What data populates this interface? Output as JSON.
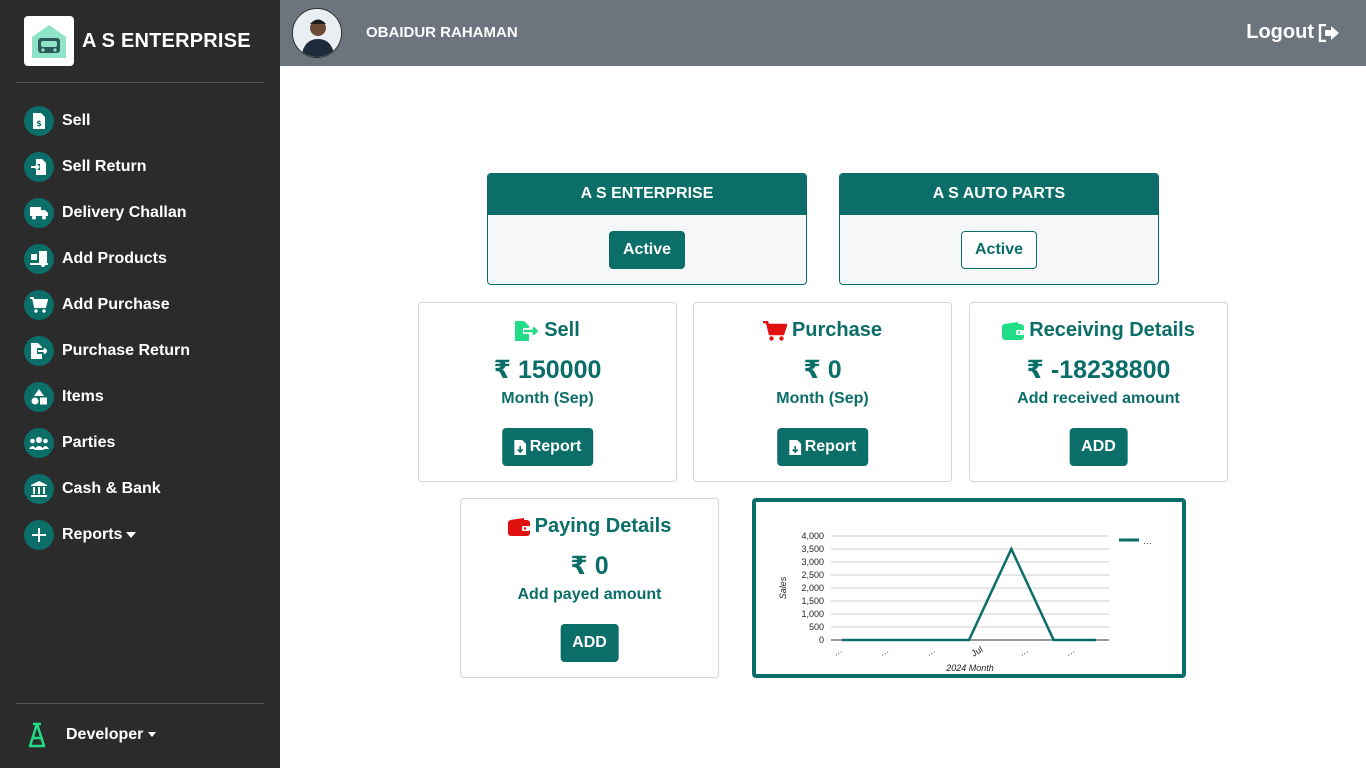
{
  "brand": {
    "name": "A S ENTERPRISE"
  },
  "sidebar": {
    "items": [
      {
        "label": "Sell",
        "icon": "invoice-icon"
      },
      {
        "label": "Sell Return",
        "icon": "file-import-icon"
      },
      {
        "label": "Delivery Challan",
        "icon": "truck-icon"
      },
      {
        "label": "Add Products",
        "icon": "truck-loading-icon"
      },
      {
        "label": "Add Purchase",
        "icon": "cart-icon"
      },
      {
        "label": "Purchase Return",
        "icon": "file-export-icon"
      },
      {
        "label": "Items",
        "icon": "shapes-icon"
      },
      {
        "label": "Parties",
        "icon": "users-icon"
      },
      {
        "label": "Cash & Bank",
        "icon": "bank-icon"
      },
      {
        "label": "Reports",
        "icon": "plus-icon"
      }
    ],
    "developer_label": "Developer"
  },
  "header": {
    "user_name": "OBAIDUR RAHAMAN",
    "logout_label": "Logout"
  },
  "companies": [
    {
      "name": "A S ENTERPRISE",
      "status": "Active"
    },
    {
      "name": "A S AUTO PARTS",
      "status": "Active"
    }
  ],
  "stats": {
    "sell": {
      "title": "Sell",
      "value": "₹ 150000",
      "sub": "Month (Sep)",
      "button": "Report"
    },
    "purchase": {
      "title": "Purchase",
      "value": "₹ 0",
      "sub": "Month (Sep)",
      "button": "Report"
    },
    "receiving": {
      "title": "Receiving Details",
      "value": "₹ -18238800",
      "sub": "Add received amount",
      "button": "ADD"
    },
    "paying": {
      "title": "Paying Details",
      "value": "₹ 0",
      "sub": "Add payed amount",
      "button": "ADD"
    }
  },
  "colors": {
    "primary": "#0b6e69",
    "sidebar": "#2b2b2b",
    "topbar": "#6c757d",
    "sell_icon": "#22dd88",
    "cart_icon": "#e01010"
  },
  "chart_data": {
    "type": "line",
    "categories": [
      "…",
      "…",
      "…",
      "Jul",
      "…",
      "…"
    ],
    "x_points": 7,
    "values": [
      0,
      0,
      0,
      0,
      3500,
      0,
      0
    ],
    "xlabel": "2024 Month",
    "ylabel": "Sales",
    "ylim": [
      0,
      4000
    ],
    "yticks": [
      "4,000",
      "3,500",
      "3,000",
      "2,500",
      "2,000",
      "1,500",
      "1,000",
      "500",
      "0"
    ],
    "legend": "…",
    "legend_position": "top-right",
    "grid": true
  }
}
